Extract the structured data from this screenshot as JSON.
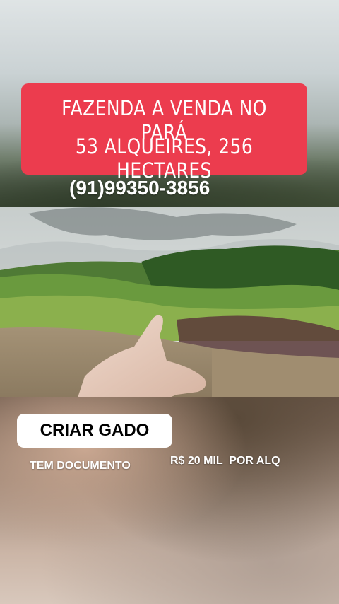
{
  "headline": {
    "line1": "FAZENDA  A VENDA NO PARÁ",
    "line2": "53 ALQUEIRES, 256 HECTARES"
  },
  "phone": "(91)99350-3856",
  "tags": {
    "purpose": "CRIAR GADO",
    "document": "TEM DOCUMENTO",
    "price": "R$ 20 MIL  POR ALQ"
  },
  "colors": {
    "headline_bg": "#ec3c4e",
    "tag_bg": "#ffffff"
  }
}
